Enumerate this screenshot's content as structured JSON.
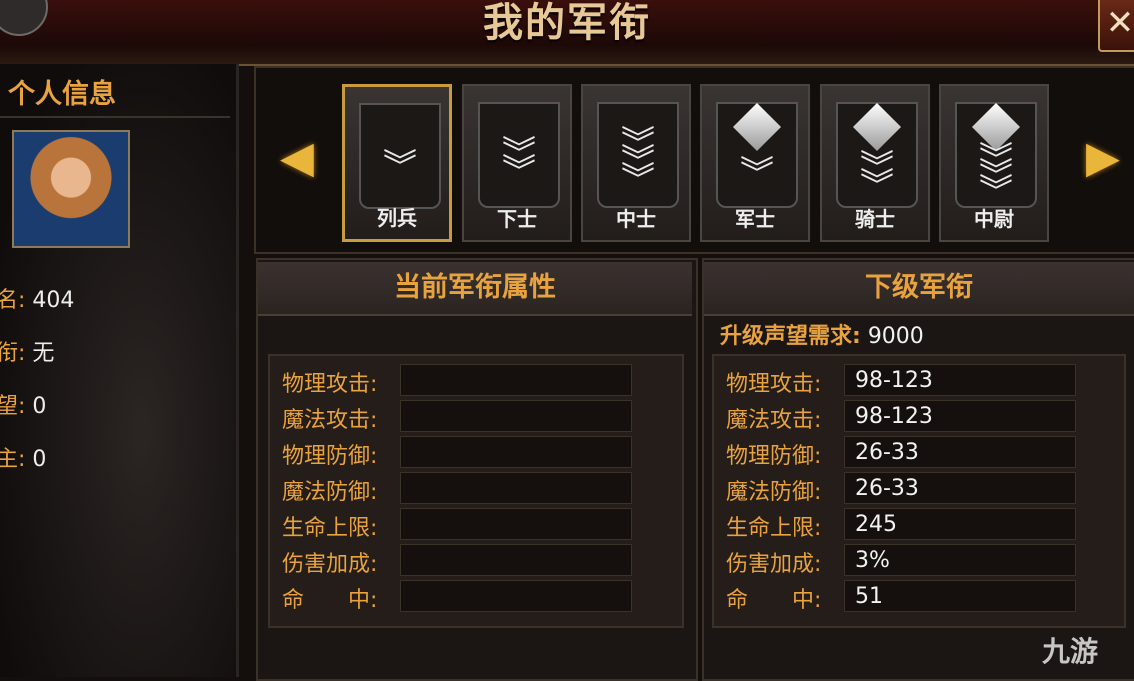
{
  "title": "我的军衔",
  "personal_title": "个人信息",
  "stats": [
    {
      "label": "名:",
      "value": "404"
    },
    {
      "label": "衔:",
      "value": "无"
    },
    {
      "label": "望:",
      "value": "0"
    },
    {
      "label": "主:",
      "value": "0"
    }
  ],
  "ranks": [
    "列兵",
    "下士",
    "中士",
    "军士",
    "骑士",
    "中尉"
  ],
  "current": {
    "title": "当前军衔属性",
    "rows": [
      {
        "label": "物理攻击:",
        "value": ""
      },
      {
        "label": "魔法攻击:",
        "value": ""
      },
      {
        "label": "物理防御:",
        "value": ""
      },
      {
        "label": "魔法防御:",
        "value": ""
      },
      {
        "label": "生命上限:",
        "value": ""
      },
      {
        "label": "伤害加成:",
        "value": ""
      },
      {
        "label": "命　　中:",
        "value": ""
      }
    ]
  },
  "next": {
    "title": "下级军衔",
    "req_label": "升级声望需求:",
    "req_value": "9000",
    "rows": [
      {
        "label": "物理攻击:",
        "value": "98-123"
      },
      {
        "label": "魔法攻击:",
        "value": "98-123"
      },
      {
        "label": "物理防御:",
        "value": "26-33"
      },
      {
        "label": "魔法防御:",
        "value": "26-33"
      },
      {
        "label": "生命上限:",
        "value": "245"
      },
      {
        "label": "伤害加成:",
        "value": "3%"
      },
      {
        "label": "命　　中:",
        "value": "51"
      }
    ]
  },
  "watermark": "九游",
  "icons": {
    "prev": "arrow-left-icon",
    "next": "arrow-right-icon",
    "close": "close-icon"
  }
}
